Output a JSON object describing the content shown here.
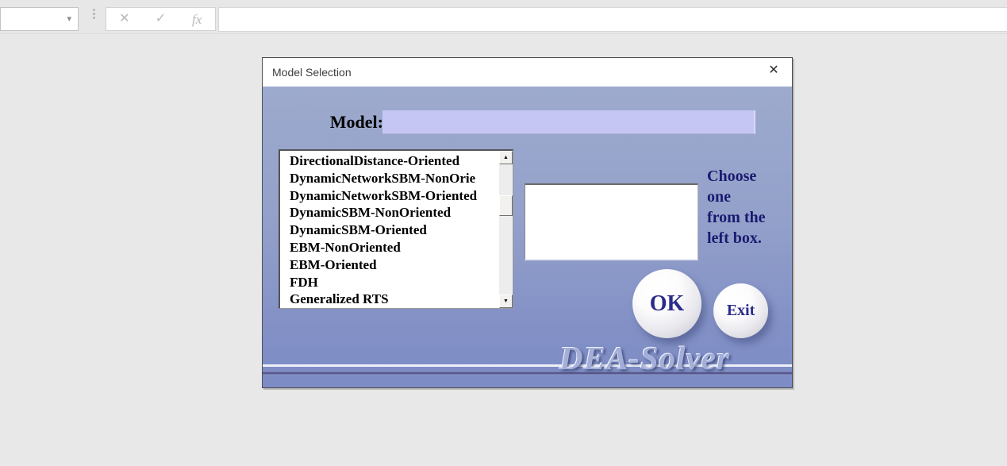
{
  "excel_bar": {
    "name_box_value": "",
    "dropdown_icon": "▾",
    "drag_handle_icon": "⋮",
    "cancel_icon": "✕",
    "enter_icon": "✓",
    "fx_icon": "fx",
    "formula_value": ""
  },
  "dialog": {
    "title": "Model Selection",
    "close_icon": "✕",
    "model_label": "Model:",
    "model_value": "",
    "models": [
      "DirectionalDistance-Oriented",
      "DynamicNetworkSBM-NonOrie",
      "DynamicNetworkSBM-Oriented",
      "DynamicSBM-NonOriented",
      "DynamicSBM-Oriented",
      "EBM-NonOriented",
      "EBM-Oriented",
      "FDH",
      "Generalized RTS"
    ],
    "selected_model": "",
    "hint_lines": [
      "Choose",
      "one",
      "from the",
      "left box."
    ],
    "scroll_up_icon": "▲",
    "scroll_down_icon": "▼",
    "ok_label": "OK",
    "exit_label": "Exit",
    "watermark": "DEA-Solver"
  },
  "colors": {
    "page_bg": "#e8e8e8",
    "dialog_bg_top": "#9daacd",
    "dialog_bg_bottom": "#7d8cc5",
    "input_bg": "#c6c6f4",
    "hint_text": "#1a1a70",
    "button_text": "#2b2b8c",
    "purple_line": "#56578f",
    "watermark_text": "#a3afd8"
  }
}
